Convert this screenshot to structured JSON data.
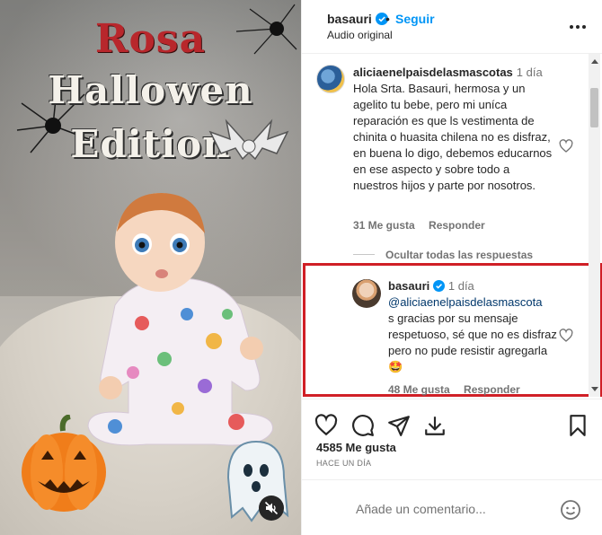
{
  "media": {
    "title_line1": "Rosa",
    "title_line2": "Hallowen",
    "title_line3": "Edition",
    "muted": true
  },
  "header": {
    "username": "basauri",
    "verified": true,
    "separator": "•",
    "follow_label": "Seguir",
    "audio_label": "Audio original",
    "more_icon": "more-horizontal-icon"
  },
  "comments": [
    {
      "username": "aliciaenelpaisdelasmascotas",
      "time": "1 día",
      "text": "Hola Srta. Basauri, hermosa y un agelito tu bebe, pero mi uníca reparación es que ls vestimenta de chinita o huasita chilena no es disfraz, en buena lo digo, debemos educarnos en ese aspecto y sobre todo a nuestros hijos y parte por nosotros.",
      "likes_label": "31 Me gusta",
      "reply_label": "Responder"
    }
  ],
  "hide_replies_label": "Ocultar todas las respuestas",
  "reply": {
    "username": "basauri",
    "verified": true,
    "time": "1 día",
    "mention": "@aliciaenelpaisdelasmascota",
    "text_after_mention": "s gracias por su mensaje respetuoso, sé que no es disfraz pero no pude resistir agregarla",
    "emoji": "🤩",
    "likes_label": "48 Me gusta",
    "reply_label": "Responder"
  },
  "actions": {
    "like_icon": "heart-icon",
    "comment_icon": "comment-icon",
    "share_icon": "send-icon",
    "save_download_icon": "download-icon",
    "bookmark_icon": "bookmark-icon"
  },
  "likes_count_label": "4585 Me gusta",
  "posted_when": "HACE UN DÍA",
  "add_comment": {
    "placeholder": "Añade un comentario...",
    "emoji_icon": "smiley-icon"
  },
  "colors": {
    "accent": "#0095f6",
    "highlight_border": "#d01f26",
    "mention": "#00376b",
    "muted_text": "#737373"
  }
}
